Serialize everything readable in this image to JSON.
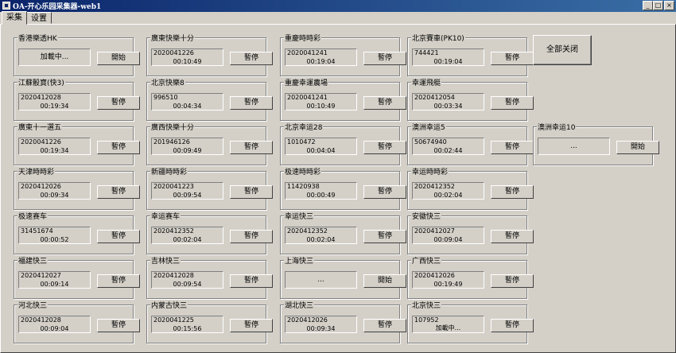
{
  "window": {
    "title": "OA-开心乐园采集器-web1"
  },
  "tabs": [
    "采集",
    "设置"
  ],
  "close_all_label": "全部关闭",
  "panels": [
    {
      "id": "p0",
      "title": "香港樂透HK",
      "center": "加載中...",
      "button": "開始"
    },
    {
      "id": "p1",
      "title": "廣東快樂十分",
      "line1": "2020041226",
      "line2": "00:10:49",
      "button": "暫停"
    },
    {
      "id": "p2",
      "title": "重慶時時彩",
      "line1": "2020041241",
      "line2": "00:19:04",
      "button": "暫停"
    },
    {
      "id": "p3",
      "title": "北京賽車(PK10)",
      "line1": "744421",
      "line2": "00:19:04",
      "button": "暫停"
    },
    {
      "id": "p4",
      "title": "江蘇骰寶(快3)",
      "line1": "2020412028",
      "line2": "00:19:34",
      "button": "暫停"
    },
    {
      "id": "p5",
      "title": "北京快樂8",
      "line1": "996510",
      "line2": "00:04:34",
      "button": "暫停"
    },
    {
      "id": "p6",
      "title": "重慶幸運農場",
      "line1": "2020041241",
      "line2": "00:10:49",
      "button": "暫停"
    },
    {
      "id": "p7",
      "title": "幸運飛艇",
      "line1": "2020412054",
      "line2": "00:03:34",
      "button": "暫停"
    },
    {
      "id": "p8",
      "title": "廣東十一選五",
      "line1": "2020041226",
      "line2": "00:19:34",
      "button": "暫停"
    },
    {
      "id": "p9",
      "title": "廣西快樂十分",
      "line1": "201946126",
      "line2": "00:09:49",
      "button": "暫停"
    },
    {
      "id": "p10",
      "title": "北京幸运28",
      "line1": "1010472",
      "line2": "00:04:04",
      "button": "暫停"
    },
    {
      "id": "p11",
      "title": "澳洲幸运5",
      "line1": "50674940",
      "line2": "00:02:44",
      "button": "暫停"
    },
    {
      "id": "p12",
      "title": "澳洲幸运10",
      "center": "...",
      "button": "開始"
    },
    {
      "id": "p13",
      "title": "天津時時彩",
      "line1": "2020412026",
      "line2": "00:09:34",
      "button": "暫停"
    },
    {
      "id": "p14",
      "title": "新疆時時彩",
      "line1": "2020041223",
      "line2": "00:09:54",
      "button": "暫停"
    },
    {
      "id": "p15",
      "title": "极速時時彩",
      "line1": "11420938",
      "line2": "00:00:49",
      "button": "暫停"
    },
    {
      "id": "p16",
      "title": "幸运時時彩",
      "line1": "2020412352",
      "line2": "00:02:04",
      "button": "暫停"
    },
    {
      "id": "p17",
      "title": "极速赛车",
      "line1": "31451674",
      "line2": "00:00:52",
      "button": "暫停"
    },
    {
      "id": "p18",
      "title": "幸运赛车",
      "line1": "2020412352",
      "line2": "00:02:04",
      "button": "暫停"
    },
    {
      "id": "p19",
      "title": "幸运快三",
      "line1": "2020412352",
      "line2": "00:02:04",
      "button": "暫停"
    },
    {
      "id": "p20",
      "title": "安徽快三",
      "line1": "2020412027",
      "line2": "00:09:04",
      "button": "暫停"
    },
    {
      "id": "p21",
      "title": "福建快三",
      "line1": "2020412027",
      "line2": "00:09:14",
      "button": "暫停"
    },
    {
      "id": "p22",
      "title": "吉林快三",
      "line1": "2020412028",
      "line2": "00:09:54",
      "button": "暫停"
    },
    {
      "id": "p23",
      "title": "上海快三",
      "center": "...",
      "button": "開始"
    },
    {
      "id": "p24",
      "title": "广西快三",
      "line1": "2020412026",
      "line2": "00:19:49",
      "button": "暫停"
    },
    {
      "id": "p25",
      "title": "河北快三",
      "line1": "2020412028",
      "line2": "00:09:04",
      "button": "暫停"
    },
    {
      "id": "p26",
      "title": "内蒙古快三",
      "line1": "2020041225",
      "line2": "00:15:56",
      "button": "暫停"
    },
    {
      "id": "p27",
      "title": "湖北快三",
      "line1": "2020412026",
      "line2": "00:09:34",
      "button": "暫停"
    },
    {
      "id": "p28",
      "title": "北京快三",
      "line1": "107952",
      "line2": "加載中...",
      "button": "暫停"
    }
  ]
}
